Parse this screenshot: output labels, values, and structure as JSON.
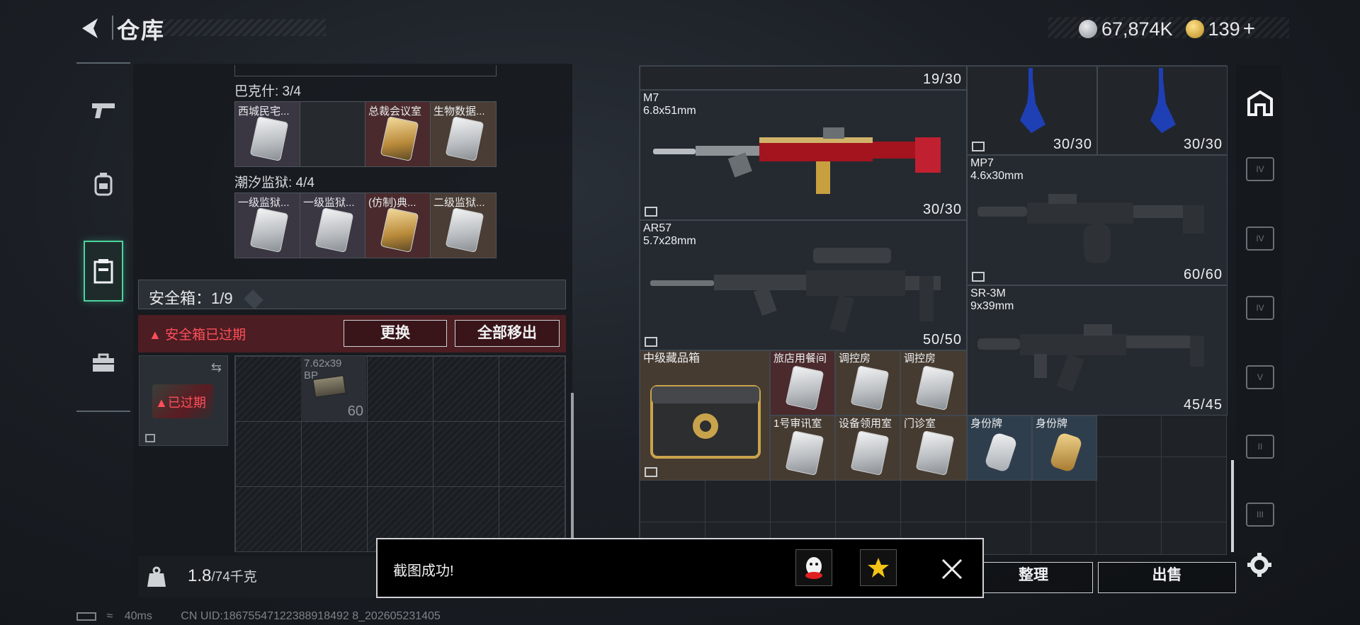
{
  "header": {
    "title": "仓库",
    "currency_primary": "67,874K",
    "currency_secondary": "139"
  },
  "left_nav": {
    "items": [
      {
        "name": "weapons",
        "icon": "pistol-icon"
      },
      {
        "name": "gear",
        "icon": "backpack-icon"
      },
      {
        "name": "storage",
        "icon": "container-icon",
        "active": true
      },
      {
        "name": "toolbox",
        "icon": "briefcase-icon"
      }
    ]
  },
  "key_groups": [
    {
      "label": "巴克什: 3/4",
      "slots": [
        {
          "label": "西城民宅...",
          "bg": "purple",
          "card": "silver"
        },
        {
          "label": "",
          "bg": "dark",
          "card": ""
        },
        {
          "label": "总裁会议室",
          "bg": "red",
          "card": "gold"
        },
        {
          "label": "生物数据...",
          "bg": "brown",
          "card": "silver"
        }
      ]
    },
    {
      "label": "潮汐监狱: 4/4",
      "slots": [
        {
          "label": "一级监狱...",
          "bg": "purple",
          "card": "silver"
        },
        {
          "label": "一级监狱...",
          "bg": "purple",
          "card": "silver"
        },
        {
          "label": "(仿制)典...",
          "bg": "red",
          "card": "gold"
        },
        {
          "label": "二级监狱...",
          "bg": "brown",
          "card": "silver"
        }
      ]
    }
  ],
  "safe_box": {
    "title": "安全箱：1/9",
    "help": "?",
    "expired_msg": "安全箱已过期",
    "replace_btn": "更换",
    "remove_all_btn": "全部移出",
    "thumb_badge": "已过期",
    "ammo_name": "7.62x39\nBP",
    "ammo_count": "60"
  },
  "weight": {
    "current": "1.8",
    "max": "/74千克"
  },
  "stash_items": [
    {
      "id": "m7",
      "name": "M7\n6.8x51mm",
      "count": "30/30"
    },
    {
      "id": "ar57",
      "name": "AR57\n5.7x28mm",
      "count": "50/50"
    },
    {
      "id": "mp7",
      "name": "MP7\n4.6x30mm",
      "count": "60/60"
    },
    {
      "id": "sr3m",
      "name": "SR-3M\n9x39mm",
      "count": "45/45"
    },
    {
      "id": "top",
      "name": "",
      "count": "19/30"
    },
    {
      "id": "stock1",
      "name": "",
      "count": "30/30"
    },
    {
      "id": "stock2",
      "name": "",
      "count": "30/30"
    },
    {
      "id": "crate",
      "name": "中级藏品箱",
      "count": ""
    },
    {
      "id": "key1",
      "name": "旅店用餐间",
      "count": ""
    },
    {
      "id": "key2",
      "name": "调控房",
      "count": ""
    },
    {
      "id": "key3",
      "name": "调控房",
      "count": ""
    },
    {
      "id": "key4",
      "name": "1号审讯室",
      "count": ""
    },
    {
      "id": "key5",
      "name": "设备领用室",
      "count": ""
    },
    {
      "id": "key6",
      "name": "门诊室",
      "count": ""
    },
    {
      "id": "tag1",
      "name": "身份牌",
      "count": ""
    },
    {
      "id": "tag2",
      "name": "身份牌",
      "count": ""
    }
  ],
  "right_strip": {
    "levels": [
      "IV",
      "IV",
      "IV",
      "V",
      "II",
      "III"
    ]
  },
  "actions": {
    "organize": "整理",
    "sell": "出售"
  },
  "toast": {
    "message": "截图成功!"
  },
  "status": {
    "ping": "40ms",
    "uid": "CN UID:18675547122388918492 8_202605231405"
  },
  "colors": {
    "accent_green": "#4bd49e",
    "warning_red": "#ff4f5a",
    "gold_card": "#b98a3a",
    "weapon_red": "#a3141e"
  }
}
